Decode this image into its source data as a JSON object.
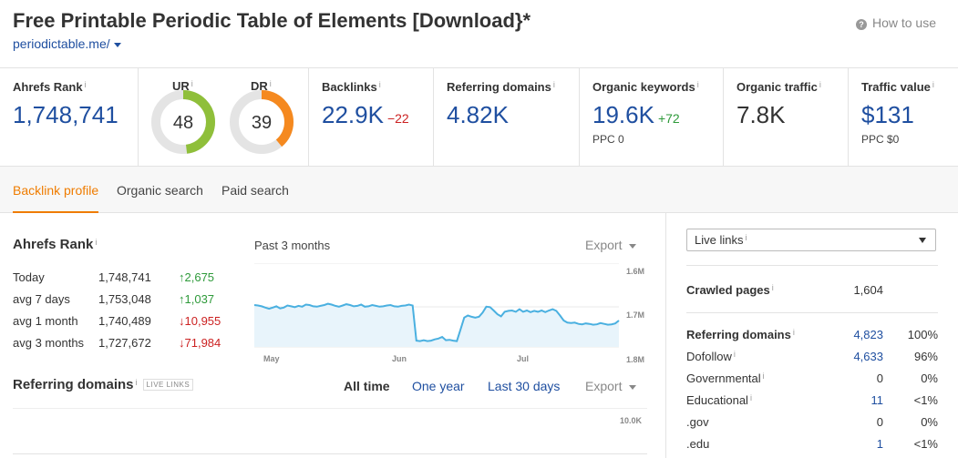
{
  "header": {
    "title": "Free Printable Periodic Table of Elements [Download}*",
    "url": "periodictable.me/",
    "how_to_use": "How to use",
    "help_glyph": "?"
  },
  "metrics": {
    "ahrefs_rank": {
      "label": "Ahrefs Rank",
      "info": "i",
      "value": "1,748,741"
    },
    "ur": {
      "label": "UR",
      "info": "i",
      "value": "48",
      "score": 48,
      "color": "#8fbf3a"
    },
    "dr": {
      "label": "DR",
      "info": "i",
      "value": "39",
      "score": 39,
      "color": "#f5891f"
    },
    "backlinks": {
      "label": "Backlinks",
      "info": "i",
      "value": "22.9K",
      "delta": "−22"
    },
    "referring_domains": {
      "label": "Referring domains",
      "info": "i",
      "value": "4.82K"
    },
    "organic_keywords": {
      "label": "Organic keywords",
      "info": "i",
      "value": "19.6K",
      "delta": "+72",
      "sub": "PPC 0"
    },
    "organic_traffic": {
      "label": "Organic traffic",
      "info": "i",
      "value": "7.8K"
    },
    "traffic_value": {
      "label": "Traffic value",
      "info": "i",
      "value": "$131",
      "sub": "PPC $0"
    }
  },
  "tabs": [
    "Backlink profile",
    "Organic search",
    "Paid search"
  ],
  "ahrefs_rank_section": {
    "title": "Ahrefs Rank",
    "info": "i",
    "rows": [
      {
        "period": "Today",
        "value": "1,748,741",
        "change": "2,675",
        "dir": "up"
      },
      {
        "period": "avg 7 days",
        "value": "1,753,048",
        "change": "1,037",
        "dir": "up"
      },
      {
        "period": "avg 1 month",
        "value": "1,740,489",
        "change": "10,955",
        "dir": "down"
      },
      {
        "period": "avg 3 months",
        "value": "1,727,672",
        "change": "71,984",
        "dir": "down"
      }
    ]
  },
  "chart_header": {
    "period": "Past 3 months",
    "export": "Export"
  },
  "chart_data": {
    "type": "area",
    "title": "Past 3 months",
    "x_tick_labels": [
      "May",
      "Jun",
      "Jul"
    ],
    "y_tick_labels": [
      "1.6M",
      "1.7M",
      "1.8M"
    ],
    "ylim": [
      1.6,
      1.8
    ],
    "y_inverted": true,
    "grid": true,
    "series": [
      {
        "color": "#4ab0e0",
        "values": [
          1.7,
          1.701,
          1.703,
          1.706,
          1.709,
          1.706,
          1.703,
          1.708,
          1.706,
          1.701,
          1.703,
          1.705,
          1.702,
          1.704,
          1.699,
          1.7,
          1.703,
          1.704,
          1.702,
          1.7,
          1.697,
          1.699,
          1.702,
          1.704,
          1.701,
          1.698,
          1.7,
          1.703,
          1.702,
          1.699,
          1.704,
          1.703,
          1.7,
          1.702,
          1.704,
          1.703,
          1.701,
          1.7,
          1.703,
          1.704,
          1.702,
          1.701,
          1.699,
          1.701,
          1.785,
          1.786,
          1.784,
          1.786,
          1.785,
          1.782,
          1.78,
          1.776,
          1.784,
          1.783,
          1.785,
          1.786,
          1.758,
          1.73,
          1.725,
          1.728,
          1.73,
          1.728,
          1.718,
          1.704,
          1.705,
          1.713,
          1.722,
          1.727,
          1.716,
          1.714,
          1.713,
          1.716,
          1.71,
          1.716,
          1.713,
          1.717,
          1.714,
          1.716,
          1.713,
          1.717,
          1.713,
          1.71,
          1.714,
          1.725,
          1.737,
          1.742,
          1.743,
          1.742,
          1.745,
          1.746,
          1.744,
          1.745,
          1.747,
          1.746,
          1.743,
          1.745,
          1.747,
          1.746,
          1.744,
          1.737
        ]
      }
    ]
  },
  "referring_section": {
    "title": "Referring domains",
    "badge": "LIVE LINKS",
    "info": "i",
    "filters": [
      "All time",
      "One year",
      "Last 30 days"
    ],
    "export": "Export",
    "axis_top": "10.0K"
  },
  "right_panel": {
    "select_label": "Live links",
    "select_info": "i",
    "crawled": {
      "label": "Crawled pages",
      "info": "i",
      "value": "1,604"
    },
    "rows": [
      {
        "label": "Referring domains",
        "info": "i",
        "value": "4,823",
        "pct": "100%",
        "bold": true,
        "link": true
      },
      {
        "label": "Dofollow",
        "info": "i",
        "value": "4,633",
        "pct": "96%",
        "bold": false,
        "link": true
      },
      {
        "label": "Governmental",
        "info": "i",
        "value": "0",
        "pct": "0%",
        "bold": false,
        "link": false
      },
      {
        "label": "Educational",
        "info": "i",
        "value": "11",
        "pct": "<1%",
        "bold": false,
        "link": true
      },
      {
        "label": ".gov",
        "info": "",
        "value": "0",
        "pct": "0%",
        "bold": false,
        "link": false
      },
      {
        "label": ".edu",
        "info": "",
        "value": "1",
        "pct": "<1%",
        "bold": false,
        "link": true
      }
    ]
  }
}
